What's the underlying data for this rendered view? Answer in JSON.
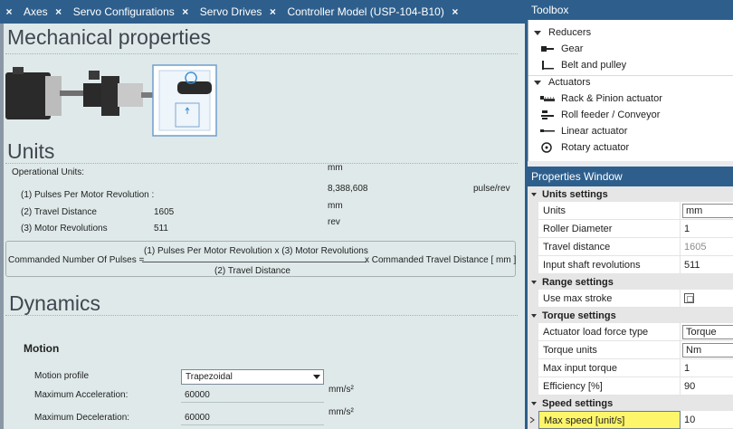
{
  "tabs": [
    {
      "label": "Axes"
    },
    {
      "label": "Servo Configurations"
    },
    {
      "label": "Servo Drives"
    },
    {
      "label": "Controller Model (USP-104-B10)"
    }
  ],
  "doc": {
    "mechanical_title": "Mechanical properties",
    "units_title": "Units",
    "operational_units_label": "Operational Units:",
    "operational_units_value": "mm",
    "pulses_label": "(1) Pulses Per Motor Revolution :",
    "pulses_value": "8,388,608",
    "pulses_unit": "pulse/rev",
    "travel_label": "(2) Travel Distance",
    "travel_value": "1605",
    "travel_unit": "mm",
    "motor_rev_label": "(3) Motor Revolutions",
    "motor_rev_value": "511",
    "motor_rev_unit": "rev",
    "formula_lhs": "Commanded Number Of Pulses =",
    "formula_numerator": "(1) Pulses Per Motor Revolution x  (3) Motor Revolutions",
    "formula_denominator": "(2) Travel Distance",
    "formula_rhs": "x Commanded Travel Distance [ mm ]",
    "dynamics_title": "Dynamics",
    "motion_title": "Motion",
    "motion_profile_label": "Motion profile",
    "motion_profile_value": "Trapezoidal",
    "max_accel_label": "Maximum Acceleration:",
    "max_accel_value": "60000",
    "max_accel_unit": "mm/s²",
    "max_decel_label": "Maximum Deceleration:",
    "max_decel_value": "60000",
    "max_decel_unit": "mm/s²"
  },
  "toolbox": {
    "title": "Toolbox",
    "groups": [
      {
        "label": "Reducers",
        "items": [
          {
            "label": "Gear",
            "icon": "gear-icon"
          },
          {
            "label": "Belt and pulley",
            "icon": "belt-pulley-icon"
          }
        ]
      },
      {
        "label": "Actuators",
        "items": [
          {
            "label": "Rack & Pinion actuator",
            "icon": "rack-pinion-icon"
          },
          {
            "label": "Roll feeder / Conveyor",
            "icon": "roll-feeder-icon"
          },
          {
            "label": "Linear actuator",
            "icon": "linear-actuator-icon"
          },
          {
            "label": "Rotary actuator",
            "icon": "rotary-actuator-icon"
          }
        ]
      }
    ]
  },
  "properties": {
    "title": "Properties Window",
    "categories": [
      {
        "label": "Units settings",
        "rows": [
          {
            "name": "Units",
            "value": "mm",
            "kind": "dropdown"
          },
          {
            "name": "Roller Diameter",
            "value": "1"
          },
          {
            "name": "Travel distance",
            "value": "1605",
            "kind": "readonly"
          },
          {
            "name": "Input shaft revolutions",
            "value": "511"
          }
        ]
      },
      {
        "label": "Range settings",
        "rows": [
          {
            "name": "Use max stroke",
            "value": "",
            "kind": "checkbox"
          }
        ]
      },
      {
        "label": "Torque settings",
        "rows": [
          {
            "name": "Actuator load force type",
            "value": "Torque",
            "kind": "dropdown"
          },
          {
            "name": "Torque units",
            "value": "Nm",
            "kind": "dropdown"
          },
          {
            "name": "Max input torque",
            "value": "1"
          },
          {
            "name": "Efficiency [%]",
            "value": "90"
          }
        ]
      },
      {
        "label": "Speed settings",
        "rows": [
          {
            "name": "Max speed [unit/s]",
            "value": "10",
            "kind": "selected"
          }
        ]
      }
    ]
  },
  "colors": {
    "accent": "#2e5f8c",
    "doc_bg": "#dfe9e9",
    "selected_row": "#fdf56a"
  }
}
